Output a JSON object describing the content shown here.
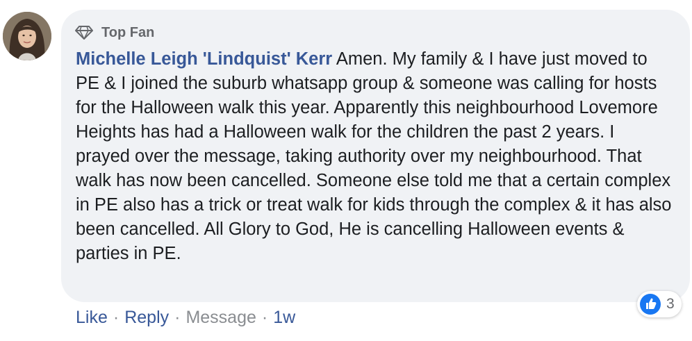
{
  "comment": {
    "badge": {
      "icon": "diamond-icon",
      "label": "Top Fan"
    },
    "author": "Michelle Leigh 'Lindquist' Kerr",
    "text": " Amen. My family & I have just moved to PE & I joined the suburb whatsapp group & someone was calling for hosts for the Halloween walk this year. Apparently this neighbourhood Lovemore Heights has had a Halloween walk for the children the past 2 years. I prayed over the message, taking authority over my neighbourhood. That walk has now been cancelled. Someone else told me that a certain complex in PE also has a trick or treat walk for kids through the complex & it has also been cancelled. All Glory to God, He is cancelling Halloween events & parties in PE.",
    "actions": {
      "like": "Like",
      "reply": "Reply",
      "message": "Message",
      "separator": "·",
      "time": "1w"
    },
    "reactions": {
      "icon": "thumbs-up-icon",
      "count": "3"
    }
  },
  "colors": {
    "bubble_bg": "#f0f2f5",
    "author": "#385898",
    "link": "#385898",
    "muted": "#8a8d91",
    "text": "#1c1e21",
    "like_blue": "#1877f2"
  }
}
